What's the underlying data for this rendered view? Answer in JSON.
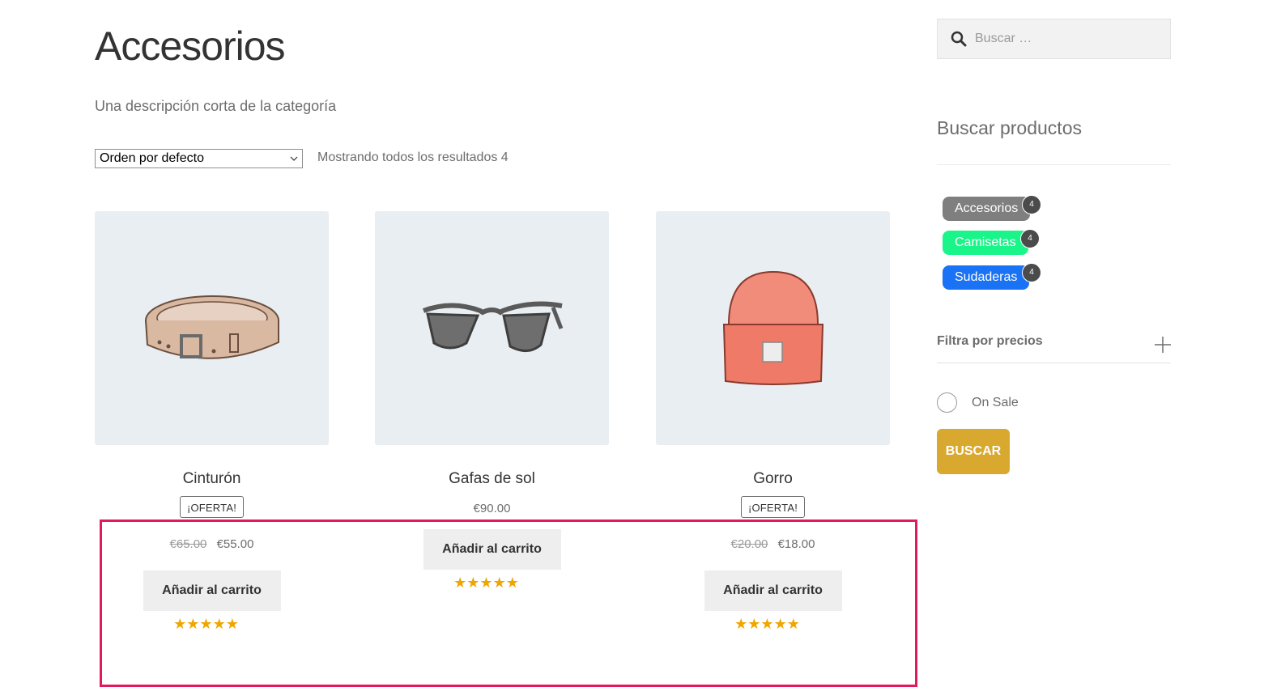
{
  "page": {
    "title": "Accesorios",
    "description": "Una descripción corta de la categoría"
  },
  "toolbar": {
    "orderby_selected": "Orden por defecto",
    "result_count": "Mostrando todos los resultados 4"
  },
  "products": [
    {
      "name": "Cinturón",
      "badge": "¡Oferta!",
      "regular_price": "€65.00",
      "sale_price": "€55.00",
      "button": "Añadir al carrito",
      "rating": "★★★★★"
    },
    {
      "name": "Gafas de sol",
      "price": "€90.00",
      "button": "Añadir al carrito",
      "rating": "★★★★★"
    },
    {
      "name": "Gorro",
      "badge": "¡Oferta!",
      "regular_price": "€20.00",
      "sale_price": "€18.00",
      "button": "Añadir al carrito",
      "rating": "★★★★★"
    }
  ],
  "sidebar": {
    "search_placeholder": "Buscar …",
    "widget_title": "Buscar productos",
    "categories": [
      {
        "label": "Accesorios",
        "count": "4",
        "color": "#7f7f7f"
      },
      {
        "label": "Camisetas",
        "count": "4",
        "color": "#1af58a"
      },
      {
        "label": "Sudaderas",
        "count": "4",
        "color": "#1a73f5"
      }
    ],
    "price_filter_title": "Filtra por precios",
    "on_sale_label": "On Sale",
    "search_button": "Buscar"
  },
  "colors": {
    "accent_button": "#d9a92f",
    "highlight_border": "#e3195f",
    "star": "#f0a500"
  }
}
